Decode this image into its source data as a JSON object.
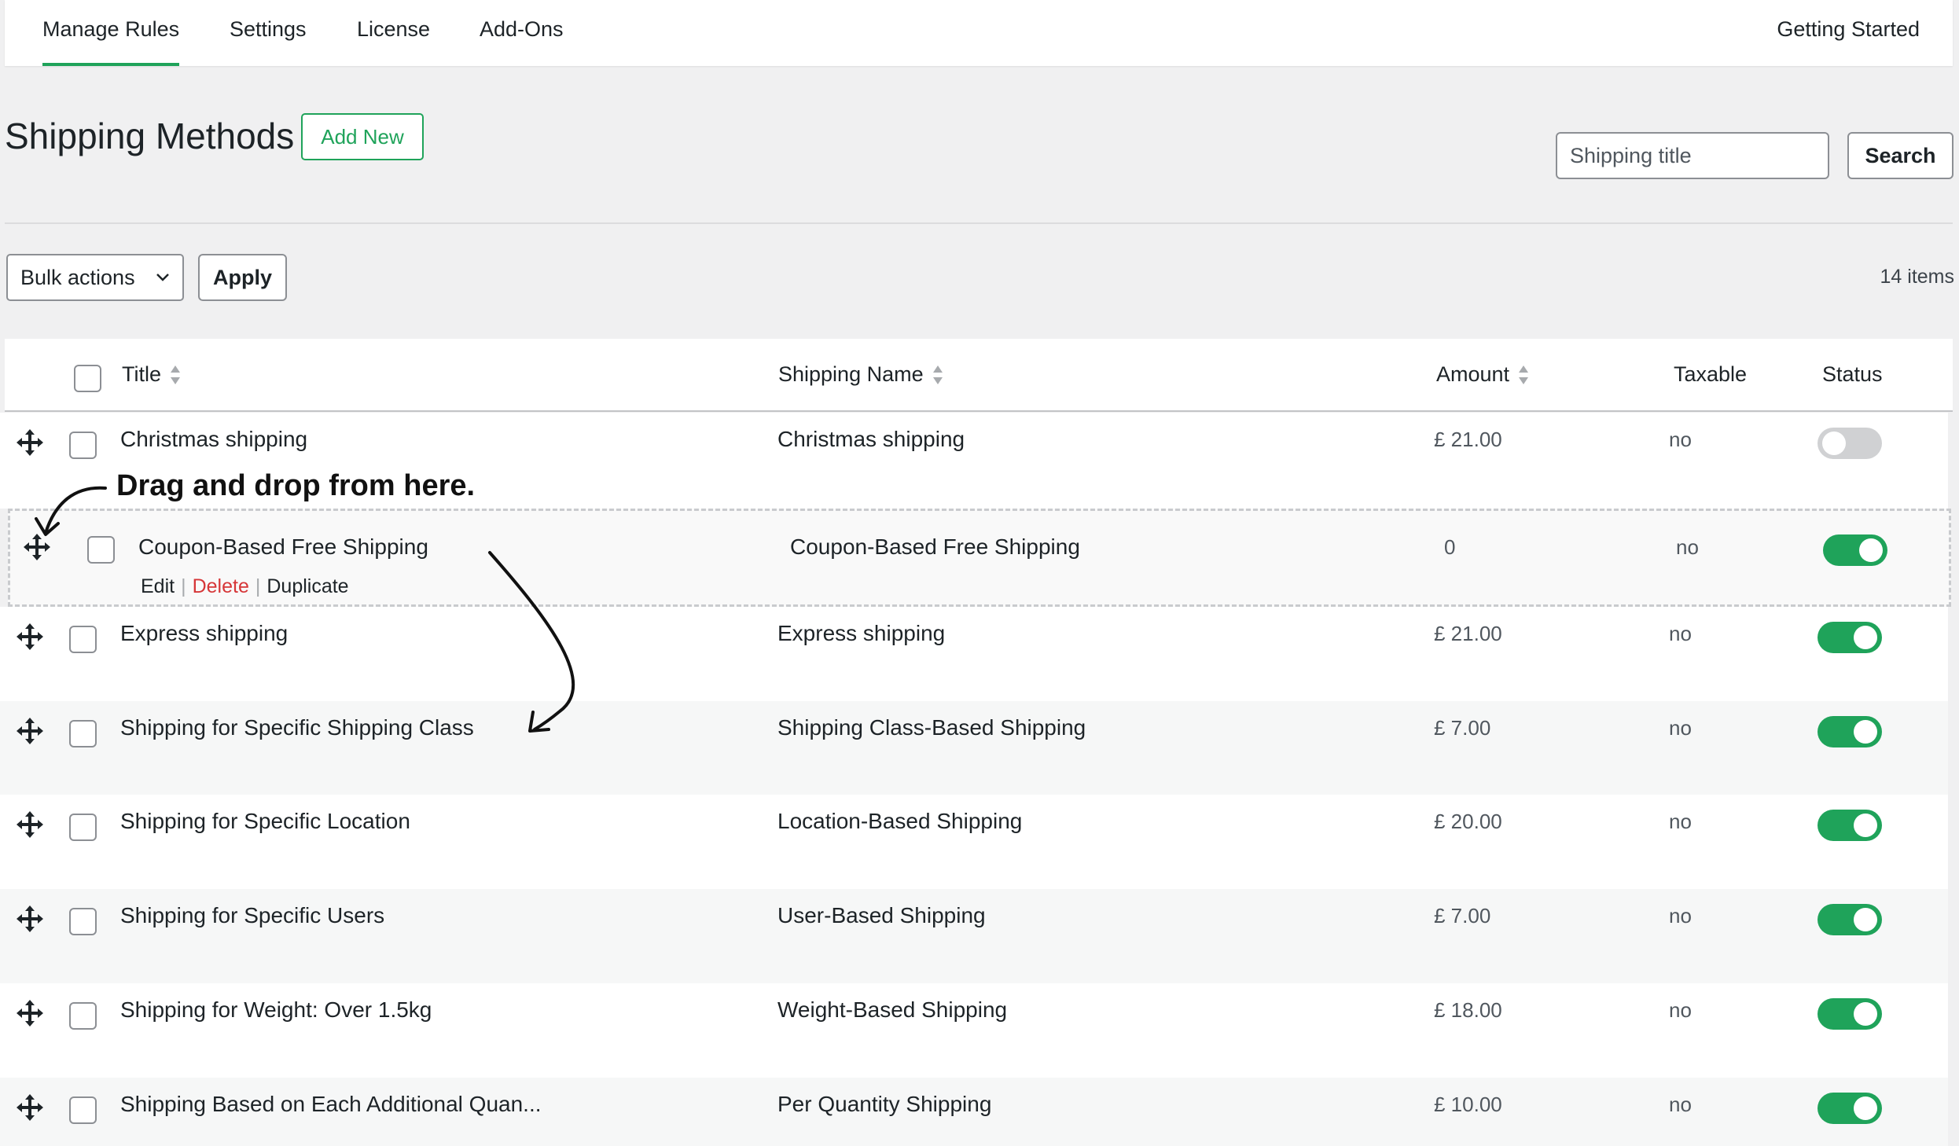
{
  "nav": {
    "tabs": [
      "Manage Rules",
      "Settings",
      "License",
      "Add-Ons"
    ],
    "active_tab": "Manage Rules",
    "right_link": "Getting Started"
  },
  "header": {
    "title": "Shipping Methods",
    "add_new": "Add New",
    "search_placeholder": "Shipping title",
    "search_button": "Search"
  },
  "toolbar": {
    "bulk_actions": "Bulk actions",
    "apply": "Apply",
    "count": "14 items"
  },
  "table": {
    "columns": [
      "Title",
      "Shipping Name",
      "Amount",
      "Taxable",
      "Status"
    ],
    "rows": [
      {
        "title": "Christmas shipping",
        "shipping_name": "Christmas shipping",
        "amount": "£ 21.00",
        "taxable": "no",
        "status": "off"
      },
      {
        "title": "Coupon-Based Free Shipping",
        "shipping_name": "Coupon-Based Free Shipping",
        "amount": "0",
        "taxable": "no",
        "status": "on"
      },
      {
        "title": "Express shipping",
        "shipping_name": "Express shipping",
        "amount": "£ 21.00",
        "taxable": "no",
        "status": "on"
      },
      {
        "title": "Shipping for Specific Shipping Class",
        "shipping_name": "Shipping Class-Based Shipping",
        "amount": "£ 7.00",
        "taxable": "no",
        "status": "on"
      },
      {
        "title": "Shipping for Specific Location",
        "shipping_name": "Location-Based Shipping",
        "amount": "£ 20.00",
        "taxable": "no",
        "status": "on"
      },
      {
        "title": "Shipping for Specific Users",
        "shipping_name": "User-Based Shipping",
        "amount": "£ 7.00",
        "taxable": "no",
        "status": "on"
      },
      {
        "title": "Shipping for Weight: Over 1.5kg",
        "shipping_name": "Weight-Based Shipping",
        "amount": "£ 18.00",
        "taxable": "no",
        "status": "on"
      },
      {
        "title": "Shipping Based on Each Additional Quan...",
        "shipping_name": "Per Quantity Shipping",
        "amount": "£ 10.00",
        "taxable": "no",
        "status": "on"
      }
    ],
    "row_actions": {
      "edit": "Edit",
      "delete": "Delete",
      "duplicate": "Duplicate"
    }
  },
  "annotation": {
    "callout": "Drag and drop from here."
  },
  "colors": {
    "accent": "#1fa35a",
    "delete": "#d63638",
    "toggle_off": "#d0d1d3"
  }
}
